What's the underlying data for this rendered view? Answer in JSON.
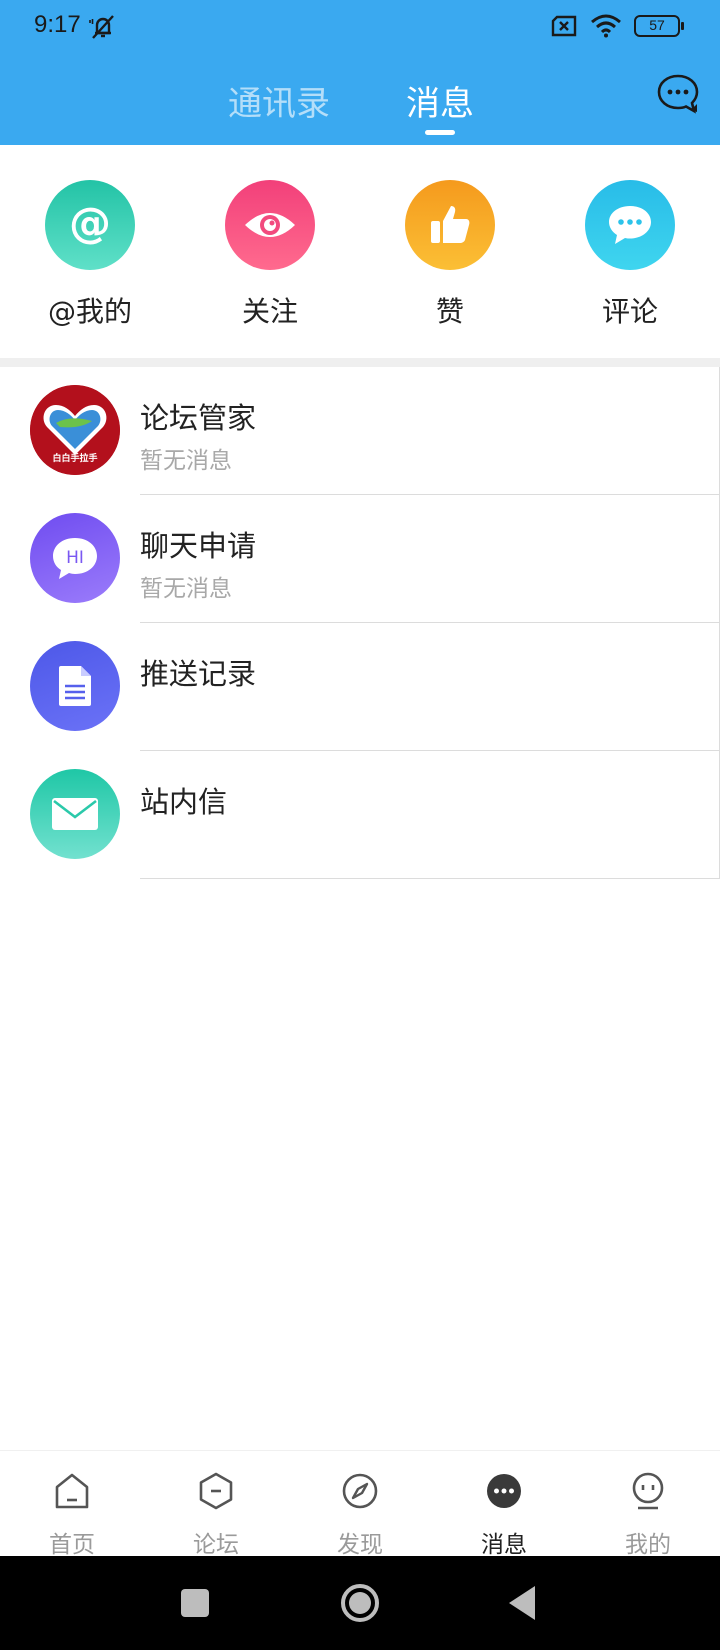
{
  "status_bar": {
    "time": "9:17",
    "battery": "57"
  },
  "header": {
    "tabs": [
      {
        "label": "通讯录",
        "active": false
      },
      {
        "label": "消息",
        "active": true
      }
    ],
    "accent_color": "#3aa9f0"
  },
  "quick_entries": [
    {
      "label": "@我的",
      "icon": "at-icon"
    },
    {
      "label": "关注",
      "icon": "eye-icon"
    },
    {
      "label": "赞",
      "icon": "thumbs-up-icon"
    },
    {
      "label": "评论",
      "icon": "comment-icon"
    }
  ],
  "list": [
    {
      "title": "论坛管家",
      "subtitle": "暂无消息",
      "avatar_text": "白白手拉手",
      "icon": "heart-logo-icon"
    },
    {
      "title": "聊天申请",
      "subtitle": "暂无消息",
      "avatar_text": "HI",
      "icon": "chat-bubble-icon"
    },
    {
      "title": "推送记录",
      "subtitle": "",
      "icon": "document-icon"
    },
    {
      "title": "站内信",
      "subtitle": "",
      "icon": "mail-icon"
    }
  ],
  "bottom_nav": [
    {
      "label": "首页",
      "icon": "home-icon",
      "active": false
    },
    {
      "label": "论坛",
      "icon": "forum-icon",
      "active": false
    },
    {
      "label": "发现",
      "icon": "compass-icon",
      "active": false
    },
    {
      "label": "消息",
      "icon": "message-icon",
      "active": true
    },
    {
      "label": "我的",
      "icon": "profile-icon",
      "active": false
    }
  ]
}
